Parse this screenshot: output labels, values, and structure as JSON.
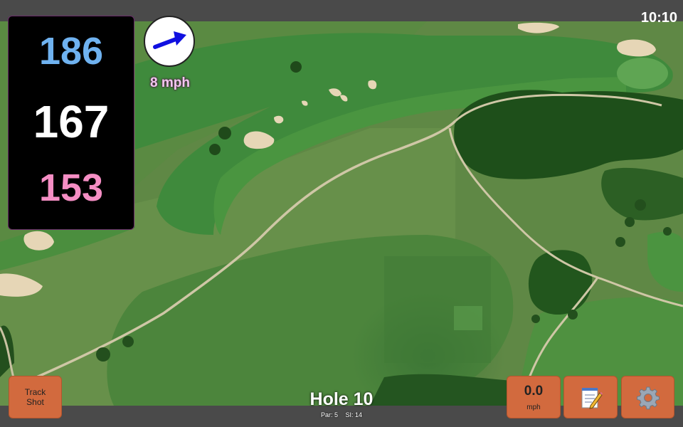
{
  "status_bar": {
    "time": "10:10"
  },
  "distances": {
    "back": "186",
    "middle": "167",
    "front": "153",
    "colors": {
      "back": "#6fb2f0",
      "middle": "#ffffff",
      "front": "#f58ec4"
    }
  },
  "wind": {
    "speed_label": "8 mph",
    "arrow_icon": "arrow-right-icon",
    "arrow_color": "#1010e0",
    "label_color": "#f2c8f0"
  },
  "hole": {
    "title": "Hole 10",
    "par_label": "Par: 5",
    "si_label": "SI: 14"
  },
  "buttons": {
    "track_shot_line1": "Track",
    "track_shot_line2": "Shot",
    "speed_value": "0.0",
    "speed_unit": "mph",
    "notes_icon": "notepad-icon",
    "settings_icon": "gear-icon",
    "accent_color": "#d26a3e"
  }
}
